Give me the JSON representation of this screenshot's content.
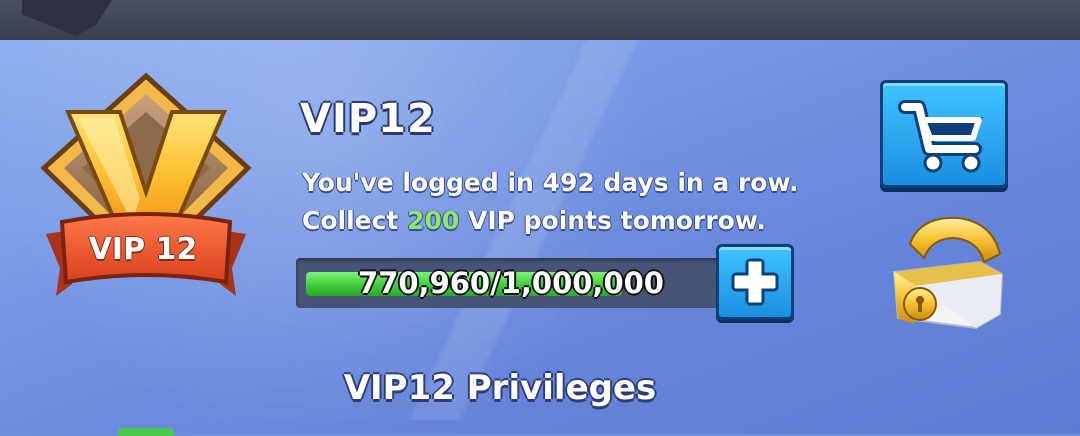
{
  "vip": {
    "title": "VIP12",
    "badge_label": "VIP 12",
    "login_line": "You've logged in 492 days in a row.",
    "collect_prefix": "Collect ",
    "collect_points": "200",
    "collect_suffix": " VIP points tomorrow.",
    "progress_text": "770,960/1,000,000",
    "progress_current": 770960,
    "progress_max": 1000000
  },
  "privileges": {
    "title": "VIP12 Privileges"
  },
  "icons": {
    "cart": "shopping-cart-icon",
    "plus": "plus-icon",
    "chest": "treasure-chest-icon",
    "badge": "vip-badge-icon"
  },
  "colors": {
    "points_highlight": "#8de86a",
    "progress_fill": "#3fcc3b",
    "button_blue": "#1a8fe0"
  }
}
